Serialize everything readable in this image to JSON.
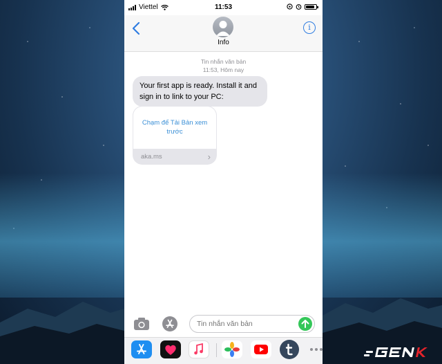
{
  "status_bar": {
    "carrier": "Viettel",
    "time": "11:53"
  },
  "nav": {
    "contact_name": "Info",
    "info_glyph": "i"
  },
  "thread": {
    "service_label": "Tin nhắn văn bản",
    "timestamp": "11:53, Hôm nay",
    "message_text": "Your first app is ready. Install it and sign in to link to your PC:",
    "link_preview": {
      "title": "Chạm để Tải Bản xem trước",
      "domain": "aka.ms",
      "chevron": "›"
    }
  },
  "composer": {
    "placeholder": "Tin nhắn văn bản"
  },
  "app_drawer": {
    "apps": [
      "app-store",
      "digital-touch",
      "music",
      "photos",
      "youtube",
      "tumblr",
      "more"
    ]
  },
  "watermark": {
    "logo_text": "GENK"
  },
  "colors": {
    "accent_blue": "#2f7de1",
    "send_green": "#34c759",
    "bubble_gray": "#e5e5ea",
    "link_blue": "#3a8fd6"
  }
}
